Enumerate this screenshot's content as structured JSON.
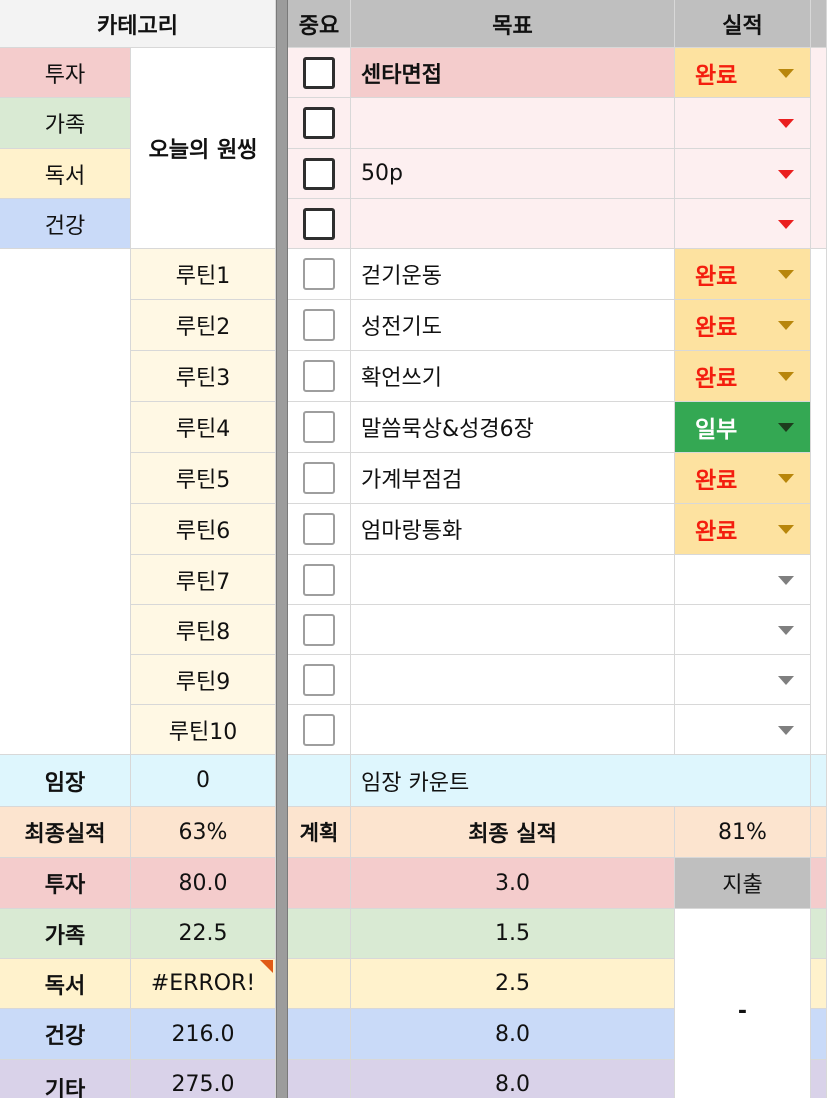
{
  "headers": {
    "category": "카테고리",
    "importance": "중요",
    "goal": "목표",
    "result": "실적"
  },
  "categories": [
    {
      "label": "투자",
      "color": "#f4cccc"
    },
    {
      "label": "가족",
      "color": "#d9ead3"
    },
    {
      "label": "독서",
      "color": "#fff2cc"
    },
    {
      "label": "건강",
      "color": "#c9daf8"
    }
  ],
  "one_thing_label": "오늘의 원씽",
  "one_thing_rows": [
    {
      "important": false,
      "goal": "센타면접",
      "result": "완료",
      "result_style": "done"
    },
    {
      "important": false,
      "goal": "",
      "result": "",
      "result_style": "empty-red"
    },
    {
      "important": false,
      "goal": "50p",
      "result": "",
      "result_style": "empty-red"
    },
    {
      "important": false,
      "goal": "",
      "result": "",
      "result_style": "empty-red"
    }
  ],
  "routines": [
    {
      "label": "루틴1",
      "important": false,
      "goal": "걷기운동",
      "result": "완료",
      "result_style": "done"
    },
    {
      "label": "루틴2",
      "important": false,
      "goal": "성전기도",
      "result": "완료",
      "result_style": "done"
    },
    {
      "label": "루틴3",
      "important": false,
      "goal": "확언쓰기",
      "result": "완료",
      "result_style": "done"
    },
    {
      "label": "루틴4",
      "important": false,
      "goal": "말씀묵상&성경6장",
      "result": "일부",
      "result_style": "partial"
    },
    {
      "label": "루틴5",
      "important": false,
      "goal": "가계부점검",
      "result": "완료",
      "result_style": "done"
    },
    {
      "label": "루틴6",
      "important": false,
      "goal": "엄마랑통화",
      "result": "완료",
      "result_style": "done"
    },
    {
      "label": "루틴7",
      "important": false,
      "goal": "",
      "result": "",
      "result_style": "empty"
    },
    {
      "label": "루틴8",
      "important": false,
      "goal": "",
      "result": "",
      "result_style": "empty"
    },
    {
      "label": "루틴9",
      "important": false,
      "goal": "",
      "result": "",
      "result_style": "empty"
    },
    {
      "label": "루틴10",
      "important": false,
      "goal": "",
      "result": "",
      "result_style": "empty"
    }
  ],
  "imjang": {
    "label": "임장",
    "value": "0",
    "note": "임장 카운트"
  },
  "final": {
    "label": "최종실적",
    "value": "63%",
    "plan_label": "계획",
    "final_label": "최종 실적",
    "final_value": "81%"
  },
  "summary": [
    {
      "label": "투자",
      "value": "80.0",
      "actual": "3.0"
    },
    {
      "label": "가족",
      "value": "22.5",
      "actual": "1.5"
    },
    {
      "label": "독서",
      "value": "#ERROR!",
      "actual": "2.5",
      "error_flag": true
    },
    {
      "label": "건강",
      "value": "216.0",
      "actual": "8.0"
    },
    {
      "label": "기타",
      "value": "275.0",
      "actual": "8.0"
    }
  ],
  "expense": {
    "label": "지출",
    "value": "-"
  },
  "colors": {
    "header_gray": "#bfbfbf",
    "done_chip": "#fde2a0",
    "done_text": "#f41e0e",
    "partial_chip": "#34a853",
    "sheet_separator": "#9c9c9c"
  },
  "icons": {
    "checkbox": "checkbox-icon",
    "dropdown": "dropdown-arrow-icon",
    "error": "error-flag-icon"
  }
}
